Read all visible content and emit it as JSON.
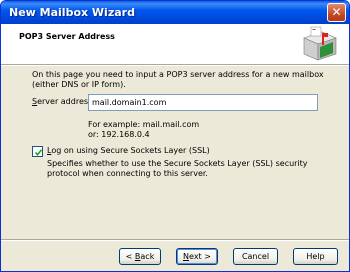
{
  "window": {
    "title": "New Mailbox Wizard",
    "close_glyph": "✕"
  },
  "header": {
    "title": "POP3 Server Address",
    "icon": "mailbox-wizard-icon"
  },
  "intro": "On this page you need to input a POP3 server address for a new mailbox (either DNS or IP form).",
  "server": {
    "label_prefix": "",
    "label_access_key": "S",
    "label_rest": "erver address:",
    "value": "mail.domain1.com"
  },
  "example": {
    "line1": "For example: mail.mail.com",
    "line2": "or: 192.168.0.4"
  },
  "ssl": {
    "checked": true,
    "label_access_key": "L",
    "label_rest": "og on using Secure Sockets Layer (SSL)",
    "description": "Specifies whether to use the Secure Sockets Layer (SSL) security protocol when connecting to this server."
  },
  "buttons": {
    "back_prefix": "< ",
    "back_key": "B",
    "back_rest": "ack",
    "next_key": "N",
    "next_rest": "ext >",
    "cancel": "Cancel",
    "help": "Help"
  },
  "colors": {
    "titlebar": "#0054e3",
    "dialog_bg": "#ece9d8",
    "input_border": "#7f9db9"
  }
}
